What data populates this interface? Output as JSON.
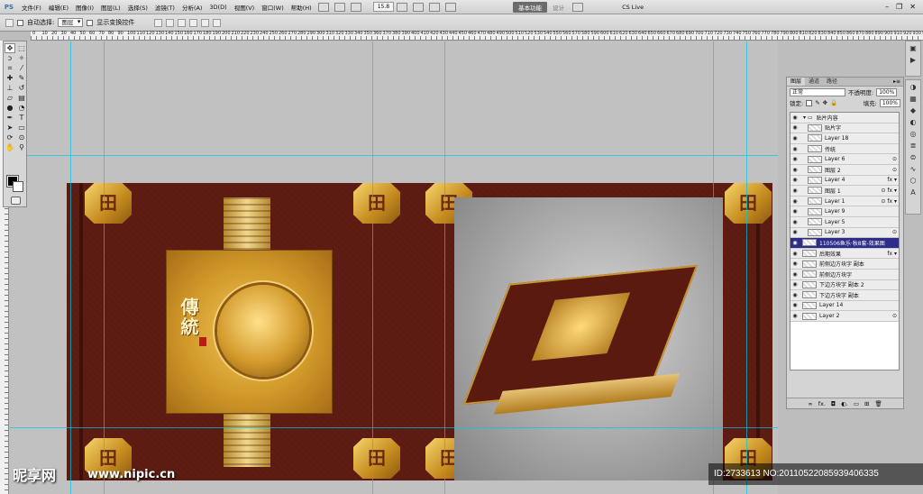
{
  "menubar": {
    "app_logo": "PS",
    "items": [
      "文件(F)",
      "编辑(E)",
      "图像(I)",
      "图层(L)",
      "选择(S)",
      "滤镜(T)",
      "分析(A)",
      "3D(D)",
      "视图(V)",
      "窗口(W)",
      "帮助(H)"
    ],
    "zoom": "15.8",
    "workspace": "基本功能",
    "design": "设计",
    "cslive": "CS Live"
  },
  "options": {
    "auto_select_label": "自动选择:",
    "auto_select_value": "图层",
    "show_transform_label": "显示变换控件"
  },
  "ruler_top_numbers": [
    "0",
    "10",
    "20",
    "30",
    "40",
    "50",
    "60",
    "70",
    "80",
    "90",
    "100",
    "110",
    "120",
    "130",
    "140",
    "150",
    "160",
    "170",
    "180",
    "190",
    "200",
    "210",
    "220",
    "230",
    "240",
    "250",
    "260",
    "270",
    "280",
    "290",
    "300",
    "310",
    "320",
    "330",
    "340",
    "350",
    "360",
    "370",
    "380",
    "390",
    "400",
    "410",
    "420",
    "430",
    "440",
    "450",
    "460",
    "470",
    "480",
    "490",
    "500",
    "510",
    "520",
    "530",
    "540",
    "550",
    "560",
    "570",
    "580",
    "590",
    "600",
    "610",
    "620",
    "630",
    "640",
    "650",
    "660",
    "670",
    "680",
    "690",
    "700",
    "710",
    "720",
    "730",
    "740",
    "750",
    "760",
    "770",
    "780",
    "790",
    "800",
    "810",
    "820",
    "830",
    "840",
    "850",
    "860",
    "870",
    "880",
    "890",
    "900",
    "910",
    "920",
    "930",
    "940"
  ],
  "toolbox": {
    "tools": [
      "move-tool",
      "marquee-tool",
      "lasso-tool",
      "magic-wand-tool",
      "crop-tool",
      "eyedropper-tool",
      "healing-tool",
      "brush-tool",
      "stamp-tool",
      "history-brush-tool",
      "eraser-tool",
      "gradient-tool",
      "blur-tool",
      "dodge-tool",
      "pen-tool",
      "type-tool",
      "path-select-tool",
      "shape-tool",
      "3d-rotate-tool",
      "3d-orbit-tool",
      "hand-tool",
      "zoom-tool"
    ],
    "fg_color": "#000000",
    "bg_color": "#ffffff"
  },
  "design": {
    "cover_title": "傳統",
    "corner_glyph": "田",
    "main_color": "#5e1c13",
    "gold_color": "#d19a2a"
  },
  "layers_panel": {
    "tabs": [
      "图层",
      "通道",
      "路径"
    ],
    "blend_mode": "正常",
    "opacity_label": "不透明度:",
    "opacity_value": "100%",
    "lock_label": "锁定:",
    "fill_label": "填充:",
    "fill_value": "100%",
    "layers": [
      {
        "name": "贴片内容",
        "group": true,
        "indent": false,
        "selected": false,
        "fx": false,
        "link": false
      },
      {
        "name": "贴片字",
        "group": false,
        "indent": true,
        "selected": false,
        "fx": false,
        "link": false
      },
      {
        "name": "Layer 18",
        "group": false,
        "indent": true,
        "selected": false,
        "fx": false,
        "link": false
      },
      {
        "name": "传统",
        "group": false,
        "indent": true,
        "selected": false,
        "fx": false,
        "link": false
      },
      {
        "name": "Layer 6",
        "group": false,
        "indent": true,
        "selected": false,
        "fx": false,
        "link": true
      },
      {
        "name": "图层 2",
        "group": false,
        "indent": true,
        "selected": false,
        "fx": false,
        "link": true
      },
      {
        "name": "Layer 4",
        "group": false,
        "indent": true,
        "selected": false,
        "fx": true,
        "link": false
      },
      {
        "name": "图层 1",
        "group": false,
        "indent": true,
        "selected": false,
        "fx": true,
        "link": true
      },
      {
        "name": "Layer 1",
        "group": false,
        "indent": true,
        "selected": false,
        "fx": true,
        "link": true
      },
      {
        "name": "Layer 9",
        "group": false,
        "indent": true,
        "selected": false,
        "fx": false,
        "link": false
      },
      {
        "name": "Layer 5",
        "group": false,
        "indent": true,
        "selected": false,
        "fx": false,
        "link": false
      },
      {
        "name": "Layer 3",
        "group": false,
        "indent": true,
        "selected": false,
        "fx": false,
        "link": true
      },
      {
        "name": "110506鱼乐·秋8套-效果图",
        "group": false,
        "indent": false,
        "selected": true,
        "fx": false,
        "link": false
      },
      {
        "name": "后期效果",
        "group": false,
        "indent": false,
        "selected": false,
        "fx": true,
        "link": false
      },
      {
        "name": "前侧边方块字 副本",
        "group": false,
        "indent": false,
        "selected": false,
        "fx": false,
        "link": false
      },
      {
        "name": "前侧边方块字",
        "group": false,
        "indent": false,
        "selected": false,
        "fx": false,
        "link": false
      },
      {
        "name": "下边方块字 副本 2",
        "group": false,
        "indent": false,
        "selected": false,
        "fx": false,
        "link": false
      },
      {
        "name": "下边方块字 副本",
        "group": false,
        "indent": false,
        "selected": false,
        "fx": false,
        "link": false
      },
      {
        "name": "Layer 14",
        "group": false,
        "indent": false,
        "selected": false,
        "fx": false,
        "link": false
      },
      {
        "name": "Layer 2",
        "group": false,
        "indent": false,
        "selected": false,
        "fx": false,
        "link": true
      }
    ],
    "footer_icons": [
      "∞",
      "fx.",
      "◘",
      "◐.",
      "▭",
      "⊞",
      "🗑"
    ]
  },
  "watermark": {
    "logo": "昵享网",
    "url": "www.nipic.cn",
    "id_text": "ID:2733613 NO:20110522085939406335"
  }
}
